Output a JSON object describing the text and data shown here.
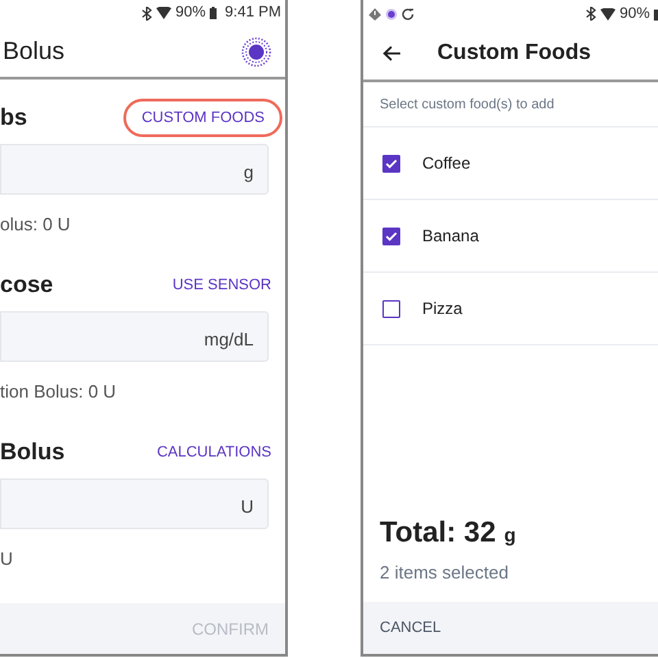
{
  "bolus_screen": {
    "status_bar": {
      "battery": "90%",
      "time": "9:41 PM"
    },
    "title": "Bolus",
    "sections": [
      {
        "title": "bs",
        "action": "CUSTOM FOODS",
        "highlighted": true,
        "unit": "g",
        "note": "olus: 0 U"
      },
      {
        "title": "cose",
        "action": "USE SENSOR",
        "highlighted": false,
        "unit": "mg/dL",
        "note": "tion Bolus: 0 U"
      },
      {
        "title": "Bolus",
        "action": "CALCULATIONS",
        "highlighted": false,
        "unit": "U",
        "note": "U"
      }
    ],
    "confirm": {
      "label": "CONFIRM",
      "disabled": true
    }
  },
  "custom_foods_screen": {
    "status_bar": {
      "battery": "90%"
    },
    "title": "Custom Foods",
    "subtitle": "Select custom food(s) to add",
    "items": [
      {
        "label": "Coffee",
        "checked": true
      },
      {
        "label": "Banana",
        "checked": true
      },
      {
        "label": "Pizza",
        "checked": false
      }
    ],
    "total": {
      "label": "Total: 32",
      "unit": "g"
    },
    "count": "2 items selected",
    "cancel": "CANCEL"
  }
}
